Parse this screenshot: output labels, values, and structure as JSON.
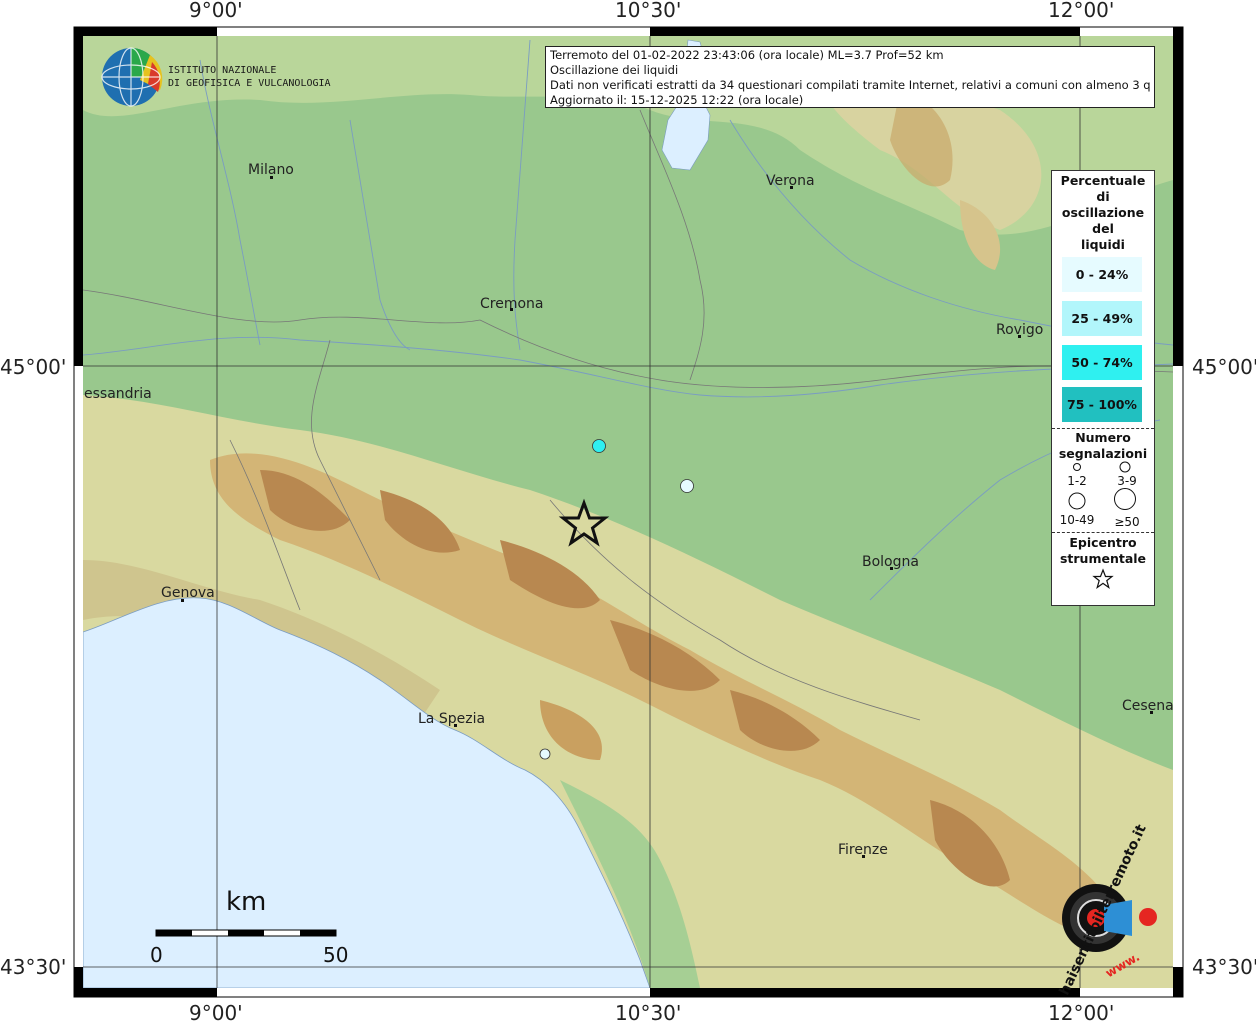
{
  "info": {
    "line1": "Terremoto del 01-02-2022 23:43:06 (ora locale) ML=3.7 Prof=52 km",
    "line2": "Oscillazione dei liquidi",
    "line3": "Dati non verificati estratti da 34 questionari compilati tramite Internet, relativi a comuni con almeno 3 questionari.",
    "line4": "Aggiornato il: 15-12-2025 12:22 (ora locale)"
  },
  "logo": {
    "line1": "ISTITUTO NAZIONALE",
    "line2": "DI GEOFISICA E VULCANOLOGIA"
  },
  "coords": {
    "lon_9": "9°00'",
    "lon_1030": "10°30'",
    "lon_12": "12°00'",
    "lat_45": "45°00'",
    "lat_4330": "43°30'"
  },
  "cities": {
    "milano": "Milano",
    "verona": "Verona",
    "cremona": "Cremona",
    "rovigo": "Rovigo",
    "alessandria": "essandria",
    "genova": "Genova",
    "bologna": "Bologna",
    "la_spezia": "La Spezia",
    "cesena": "Cesena",
    "firenze": "Firenze"
  },
  "legend": {
    "title": [
      "Percentuale",
      "di",
      "oscillazione",
      "del",
      "liquidi"
    ],
    "ranges": [
      {
        "label": "0 - 24%",
        "color": "#e6fbff"
      },
      {
        "label": "25 - 49%",
        "color": "#b2f6fb"
      },
      {
        "label": "50 - 74%",
        "color": "#2ff0f0"
      },
      {
        "label": "75 - 100%",
        "color": "#21c0c0"
      }
    ],
    "count_title": [
      "Numero",
      "segnalazioni"
    ],
    "count_labels": [
      "1-2",
      "3-9",
      "10-49",
      "≥50"
    ],
    "epi_title": [
      "Epicentro",
      "strumentale"
    ]
  },
  "scalebar": {
    "unit": "km",
    "start": "0",
    "end": "50"
  },
  "sentito": {
    "text": "haisentitoilterremoto.it",
    "prefix": "www."
  },
  "points": [
    {
      "name": "report-1",
      "level": "50 - 74%",
      "color": "#2ff0f0",
      "size_class": "3-9"
    },
    {
      "name": "report-2",
      "level": "0 - 24%",
      "color": "#e6fbff",
      "size_class": "3-9"
    },
    {
      "name": "report-3",
      "level": "0 - 24%",
      "color": "#e6fbff",
      "size_class": "1-2"
    }
  ],
  "colors": {
    "sea": "#dcefff",
    "plain": "#99c88d",
    "hills": "#e8e0a8",
    "mountains": "#c79a54"
  }
}
